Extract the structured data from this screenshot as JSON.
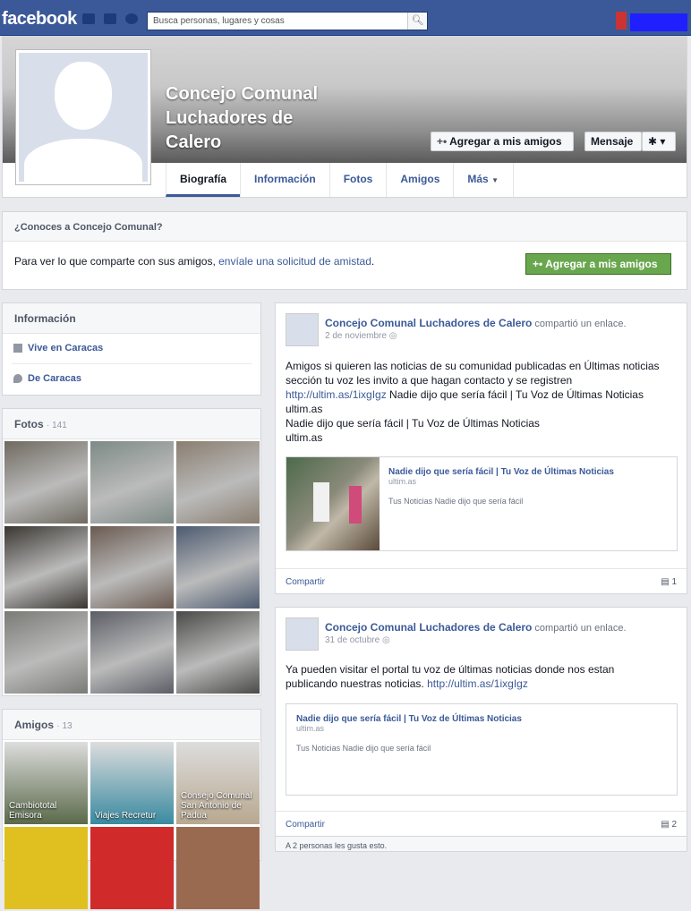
{
  "topbar": {
    "logo": "facebook",
    "search_placeholder": "Busca personas, lugares y cosas",
    "search_icon": "magnifier-icon"
  },
  "profile": {
    "name_lines": [
      "Concejo Comunal",
      "Luchadores de",
      "Calero"
    ],
    "add_friend_label": "Agregar a mis amigos",
    "message_label": "Mensaje",
    "gear_label": "✱ ▾",
    "tabs": [
      "Biografía",
      "Información",
      "Fotos",
      "Amigos",
      "Más"
    ]
  },
  "knowbox": {
    "title": "¿Conoces a Concejo Comunal?",
    "text": "Para ver lo que comparte con sus amigos, ",
    "link": "envíale una solicitud de amistad",
    "text_end": ".",
    "button": "Agregar a mis amigos"
  },
  "info_box": {
    "title": "Información",
    "rows": [
      {
        "pre": "Vive en ",
        "value": "Caracas"
      },
      {
        "pre": "De ",
        "value": "Caracas"
      }
    ]
  },
  "photos_box": {
    "title": "Fotos",
    "count": "141",
    "colors": [
      "#6f6a60",
      "#7d8a86",
      "#8a7e70",
      "#3a3631",
      "#6a5a50",
      "#4c5a70",
      "#7a7a76",
      "#5c5e66",
      "#4a4a48"
    ]
  },
  "friends_box": {
    "title": "Amigos",
    "count": "13",
    "friends": [
      {
        "name": "Cambiototal Emisora",
        "color": "#5a6a4a"
      },
      {
        "name": "Viajes Recretur",
        "color": "#3a8aa0"
      },
      {
        "name": "Consejo Comunal San Antonio de Padua",
        "color": "#b8a890"
      }
    ],
    "row2_colors": [
      "#e0c020",
      "#d02a2a",
      "#9a6a50"
    ]
  },
  "posts": [
    {
      "author": "Concejo Comunal Luchadores de Calero",
      "action": " compartió un enlace.",
      "date": "2 de noviembre",
      "lines": [
        "Amigos si quieren las noticias de su comunidad publicadas en Últimas noticias",
        "sección tu voz les invito a que hagan contacto y se registren",
        "http://ultim.as/1ixgIgz Nadie dijo que sería fácil | Tu Voz de Últimas Noticias",
        "ultim.as",
        "Nadie dijo que sería fácil | Tu Voz de Últimas Noticias",
        "ultim.as"
      ],
      "card_title": "Nadie dijo que sería fácil | Tu Voz de Últimas Noticias",
      "card_domain": "ultim.as",
      "card_desc": "Tus Noticias Nadie dijo que sería fácil",
      "share": "Compartir",
      "comments": "1"
    },
    {
      "author": "Concejo Comunal Luchadores de Calero",
      "action": " compartió un enlace.",
      "date": "31 de octubre",
      "lines": [
        "Ya pueden visitar el portal tu voz de últimas noticias donde nos estan",
        "publicando nuestras noticias. http://ultim.as/1ixgIgz"
      ],
      "card_title": "Nadie dijo que sería fácil | Tu Voz de Últimas Noticias",
      "card_domain": "ultim.as",
      "card_desc": "Tus Noticias Nadie dijo que sería fácil",
      "share": "Compartir",
      "comments": "2",
      "likes": "A 2 personas les gusta esto."
    }
  ]
}
